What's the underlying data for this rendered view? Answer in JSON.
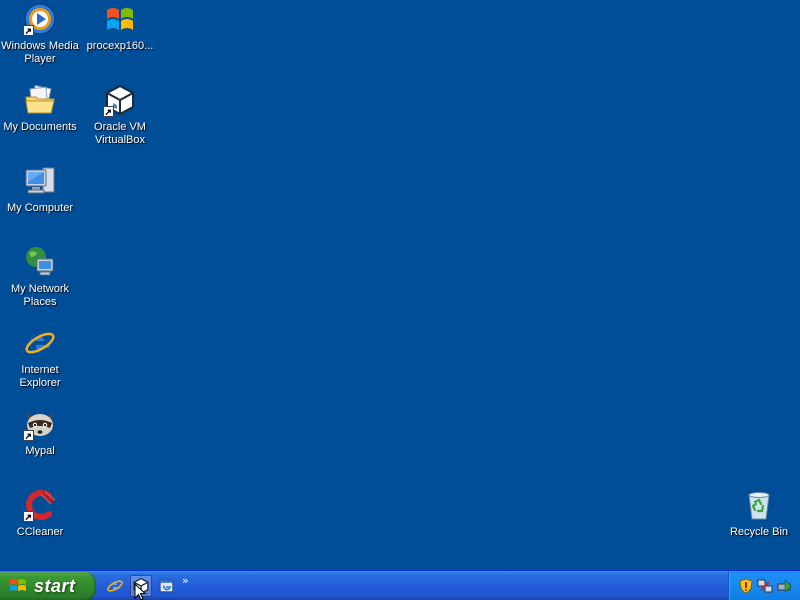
{
  "desktop": {
    "background_color": "#004e98",
    "icons": [
      {
        "label": "Windows Media Player",
        "icon": "media-player-icon"
      },
      {
        "label": "procexp160...",
        "icon": "windows-flag-icon"
      },
      {
        "label": "My Documents",
        "icon": "documents-folder-icon"
      },
      {
        "label": "Oracle VM VirtualBox",
        "icon": "virtualbox-icon"
      },
      {
        "label": "My Computer",
        "icon": "computer-icon"
      },
      {
        "label": "My Network Places",
        "icon": "network-places-icon"
      },
      {
        "label": "Internet Explorer",
        "icon": "internet-explorer-icon"
      },
      {
        "label": "Mypal",
        "icon": "mypal-raccoon-icon"
      },
      {
        "label": "CCleaner",
        "icon": "ccleaner-icon"
      },
      {
        "label": "Recycle Bin",
        "icon": "recycle-bin-icon"
      }
    ]
  },
  "taskbar": {
    "start_label": "start",
    "quick_launch": [
      {
        "icon": "internet-explorer-icon"
      },
      {
        "icon": "virtualbox-icon"
      },
      {
        "icon": "show-desktop-icon"
      }
    ],
    "overflow_label": "»",
    "tray_icons": [
      "security-shield-icon",
      "network-icon",
      "safely-remove-icon"
    ],
    "colors": {
      "taskbar_blue": "#245edb",
      "start_green": "#3c9a36",
      "tray_blue": "#1789ef"
    }
  }
}
